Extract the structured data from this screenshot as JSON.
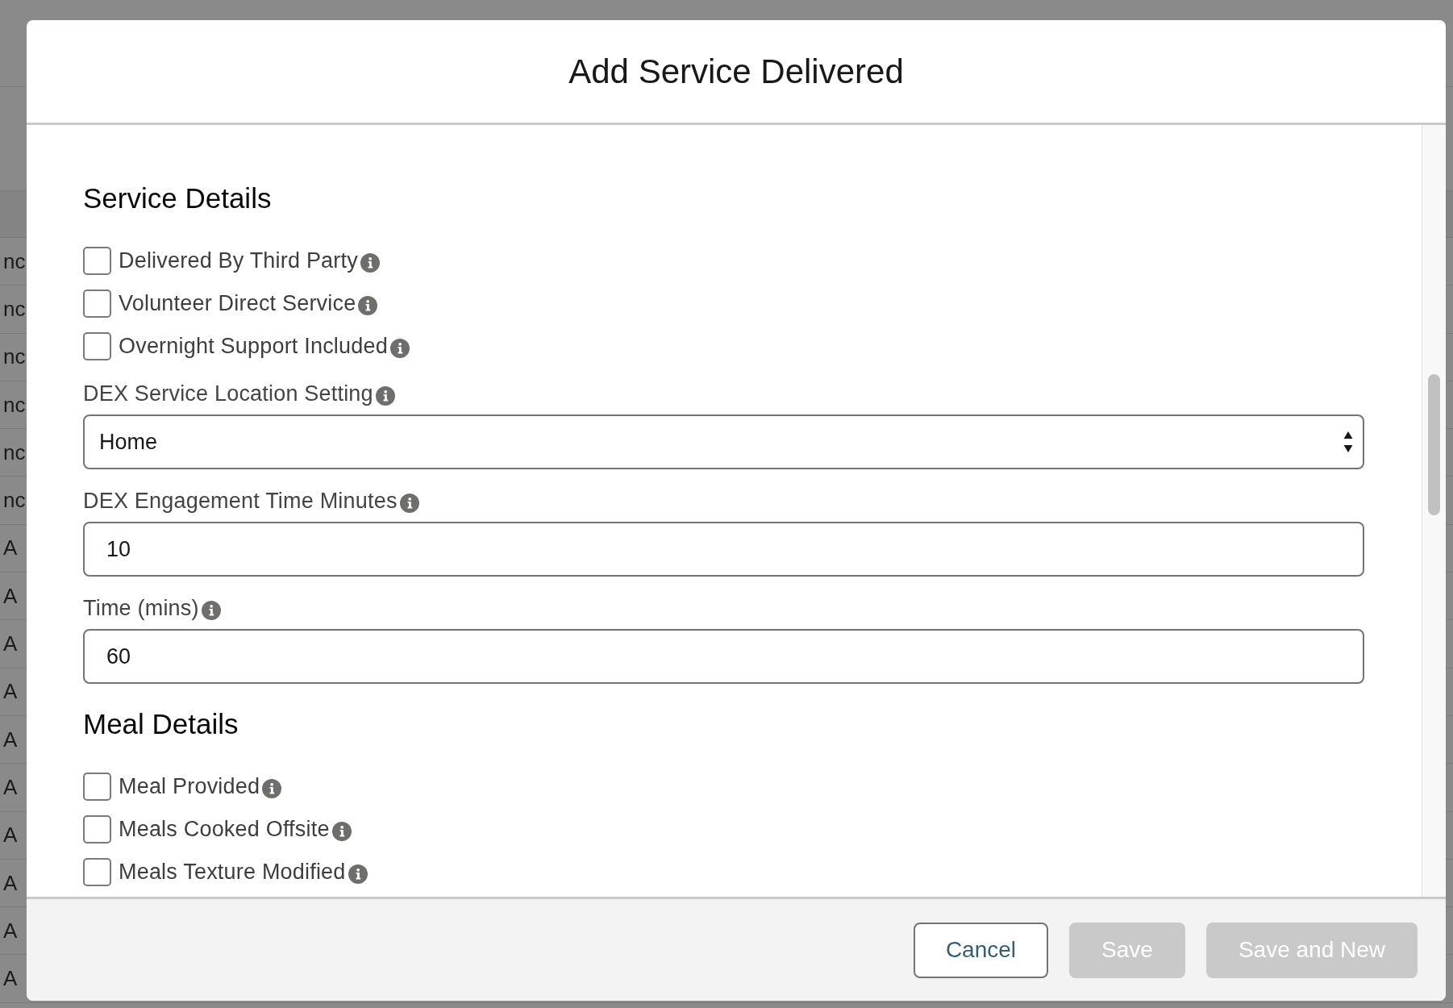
{
  "background_table": {
    "rows": [
      {
        "column_1": "nc"
      },
      {
        "column_1": "nc"
      },
      {
        "column_1": "nc"
      },
      {
        "column_1": "nc"
      },
      {
        "column_1": "nc"
      },
      {
        "column_1": "nc"
      },
      {
        "column_1": "A"
      },
      {
        "column_1": "A"
      },
      {
        "column_1": "A"
      },
      {
        "column_1": "A"
      },
      {
        "column_1": "A"
      },
      {
        "column_1": "A"
      },
      {
        "column_1": "A"
      },
      {
        "column_1": "A"
      },
      {
        "column_1": "A"
      },
      {
        "column_1": "A"
      }
    ]
  },
  "dialog": {
    "title": "Add Service Delivered",
    "sections": [
      {
        "heading": "Service Details",
        "fields": [
          {
            "kind": "checkbox",
            "label": "Delivered By Third Party",
            "checked": false
          },
          {
            "kind": "checkbox",
            "label": "Volunteer Direct Service",
            "checked": false
          },
          {
            "kind": "checkbox",
            "label": "Overnight Support Included",
            "checked": false
          },
          {
            "kind": "select",
            "label": "DEX Service Location Setting",
            "value": "Home"
          },
          {
            "kind": "input",
            "label": "DEX Engagement Time Minutes",
            "value": "10"
          },
          {
            "kind": "input",
            "label": "Time (mins)",
            "value": "60"
          }
        ]
      },
      {
        "heading": "Meal Details",
        "fields": [
          {
            "kind": "checkbox",
            "label": "Meal Provided",
            "checked": false
          },
          {
            "kind": "checkbox",
            "label": "Meals Cooked Offsite",
            "checked": false
          },
          {
            "kind": "checkbox",
            "label": "Meals Texture Modified",
            "checked": false
          }
        ]
      }
    ],
    "buttons": [
      {
        "label": "Cancel",
        "kind": "neutral",
        "disabled": false
      },
      {
        "label": "Save",
        "kind": "brand",
        "disabled": true
      },
      {
        "label": "Save and New",
        "kind": "brand",
        "disabled": true
      }
    ]
  }
}
